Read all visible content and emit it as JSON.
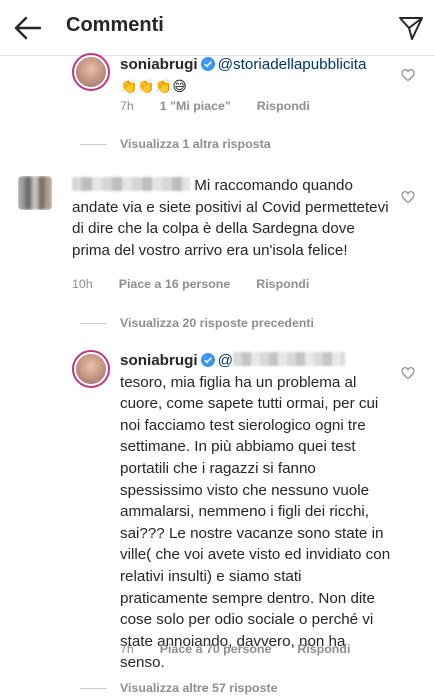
{
  "header": {
    "title": "Commenti"
  },
  "reply1": {
    "username": "soniabrugi",
    "mention": "@storiadellapubblicita",
    "emojis": "👏👏👏😅",
    "time": "7h",
    "likes": "1 \"Mi piace\"",
    "reply_label": "Rispondi"
  },
  "thread1": {
    "view_more": "Visualizza 1 altra risposta"
  },
  "comment2": {
    "text": "Mi raccomando quando andate via e siete positivi al Covid permettetevi di dire che la colpa è della Sardegna dove prima del vostro arrivo era un'isola felice!",
    "time": "10h",
    "likes": "Piace a 16 persone",
    "reply_label": "Rispondi"
  },
  "thread2": {
    "view_previous": "Visualizza 20 risposte precedenti"
  },
  "reply2": {
    "username": "soniabrugi",
    "mention_prefix": "@",
    "text": "tesoro, mia figlia ha un problema al cuore, come sapete tutti ormai, per cui noi facciamo test sierologico ogni tre settimane. In più abbiamo quei test portatili che i ragazzi si fanno spessissimo visto che nessuno vuole ammalarsi, nemmeno i figli dei ricchi, sai??? Le nostre vacanze sono state in ville( che voi avete visto ed invidiato con relativi insulti) e siamo stati praticamente sempre dentro. Non dite cose solo per odio sociale o perché vi state annoiando, davvero, non ha senso.",
    "time": "7h",
    "likes": "Piace a 70 persone",
    "reply_label": "Rispondi"
  },
  "thread3": {
    "view_more": "Visualizza altre 57 risposte"
  },
  "colors": {
    "text": "#262626",
    "secondary": "#8e8e8e",
    "mention": "#00376b",
    "verified": "#3897f0"
  }
}
